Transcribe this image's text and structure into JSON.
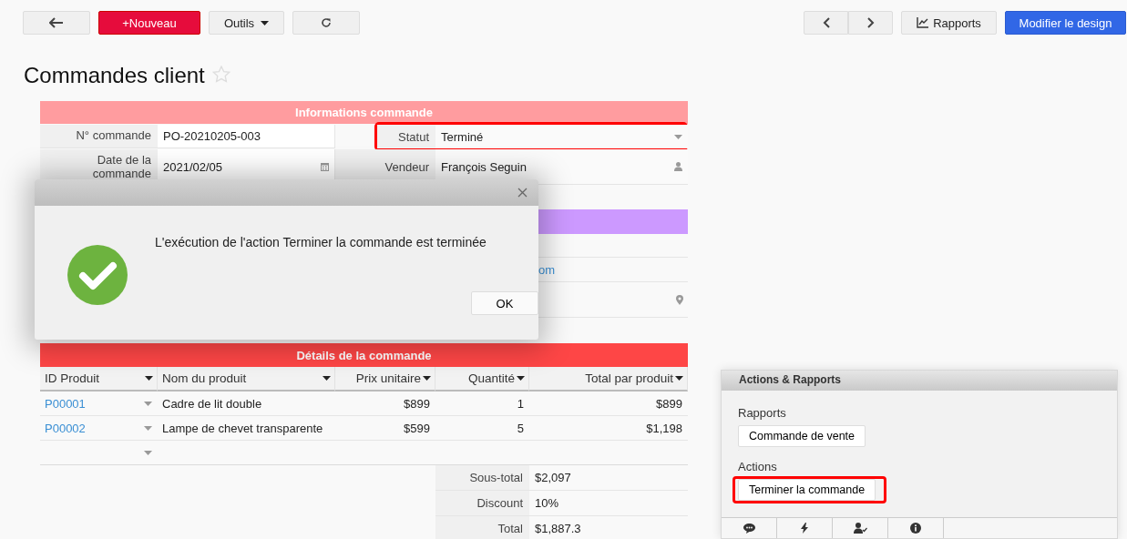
{
  "toolbar": {
    "left": [
      {
        "kind": "back"
      },
      {
        "kind": "primary",
        "label": "+Nouveau"
      },
      {
        "kind": "menu",
        "label": "Outils"
      },
      {
        "kind": "refresh"
      }
    ],
    "right": [
      {
        "kind": "prev"
      },
      {
        "kind": "next"
      },
      {
        "kind": "chart",
        "label": "Rapports"
      },
      {
        "kind": "accent",
        "label": "Modifier le design"
      }
    ]
  },
  "page_title": "Commandes client",
  "favorite": false,
  "order_info": {
    "title": "Informations commande",
    "rows": [
      [
        {
          "label": "N° commande",
          "value": "PO-20210205-003",
          "highlighted": false
        },
        {
          "label": "Statut",
          "value": "Terminé",
          "kind": "dropdown",
          "highlighted": true
        }
      ],
      [
        {
          "label": "Date de la commande",
          "value": "2021/02/05",
          "kind": "date",
          "highlighted": false
        },
        {
          "label": "Vendeur",
          "value": "François Seguin",
          "kind": "user",
          "highlighted": false
        }
      ]
    ]
  },
  "customer_section": {
    "rows": [
      {
        "kind": "empty"
      },
      {
        "kind": "link",
        "value": "om"
      },
      {
        "kind": "location"
      }
    ]
  },
  "details": {
    "title": "Détails de la commande",
    "columns": [
      {
        "label": "ID Produit",
        "kind": "text"
      },
      {
        "label": "Nom du produit",
        "kind": "text"
      },
      {
        "label": "Prix unitaire",
        "kind": "number"
      },
      {
        "label": "Quantité",
        "kind": "number"
      },
      {
        "label": "Total par produit",
        "kind": "number"
      }
    ],
    "rows": [
      {
        "kind": "item",
        "id": "P00001",
        "name": "Cadre de lit double",
        "price": "$899",
        "qty": "1",
        "total": "$899"
      },
      {
        "kind": "item",
        "id": "P00002",
        "name": "Lampe de chevet transparente",
        "price": "$599",
        "qty": "5",
        "total": "$1,198"
      },
      {
        "kind": "new"
      }
    ],
    "summary": [
      {
        "label": "Sous-total",
        "value": "$2,097"
      },
      {
        "label": "Discount",
        "value": "10%"
      },
      {
        "label": "Total",
        "value": "$1,887.3"
      }
    ]
  },
  "dialog": {
    "kind": "success",
    "message": "L'exécution de l'action Terminer la commande est terminée",
    "ok": "OK"
  },
  "panel": {
    "title": "Actions & Rapports",
    "groups": [
      {
        "heading": "Rapports",
        "buttons": [
          {
            "label": "Commande de vente",
            "highlighted": false
          }
        ]
      },
      {
        "heading": "Actions",
        "buttons": [
          {
            "label": "Terminer la commande",
            "highlighted": true
          }
        ]
      }
    ],
    "tabs": [
      {
        "kind": "comments"
      },
      {
        "kind": "bolt"
      },
      {
        "kind": "user-check"
      },
      {
        "kind": "info"
      }
    ]
  }
}
